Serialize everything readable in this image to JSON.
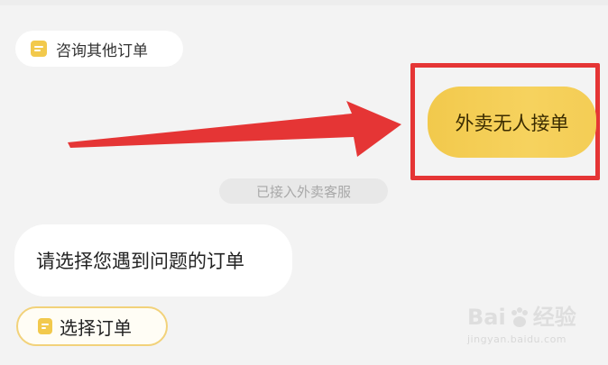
{
  "chat": {
    "consult_other_orders": "咨询其他订单",
    "no_rider_button": "外卖无人接单",
    "system_notice": "已接入外卖客服",
    "agent_message": "请选择您遇到问题的订单",
    "select_order_button": "选择订单"
  },
  "icons": {
    "consult_icon": "document-icon",
    "select_icon": "document-icon",
    "annotation_arrow": "red-arrow"
  },
  "watermark": {
    "logo_text_a": "Bai",
    "logo_text_b": "经验",
    "sub_text": "jingyan.baidu.com"
  },
  "colors": {
    "accent_yellow": "#f2c94c",
    "highlight_red": "#e53535",
    "background": "#f3f3f3"
  }
}
